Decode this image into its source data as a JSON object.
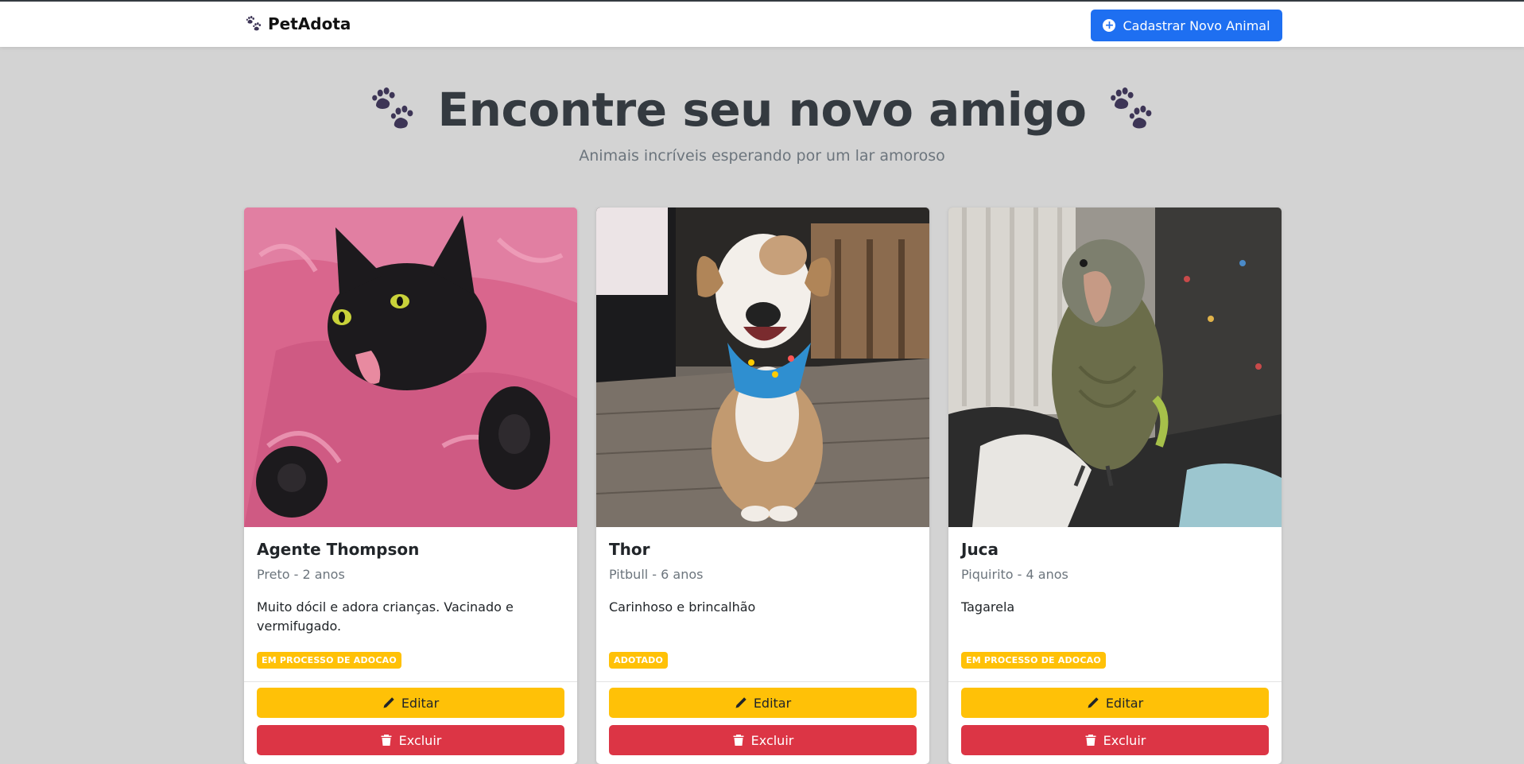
{
  "navbar": {
    "brand": "PetAdota",
    "new_button_label": "Cadastrar Novo Animal"
  },
  "hero": {
    "title": "Encontre seu novo amigo",
    "subtitle": "Animais incríveis esperando por um lar amoroso"
  },
  "cards": [
    {
      "name": "Agente Thompson",
      "breed_age": "Preto - 2 anos",
      "description": "Muito dócil e adora crianças. Vacinado e vermifugado.",
      "status": "EM PROCESSO DE ADOCAO",
      "edit_label": "Editar",
      "delete_label": "Excluir"
    },
    {
      "name": "Thor",
      "breed_age": "Pitbull - 6 anos",
      "description": "Carinhoso e brincalhão",
      "status": "ADOTADO",
      "edit_label": "Editar",
      "delete_label": "Excluir"
    },
    {
      "name": "Juca",
      "breed_age": "Piquirito - 4 anos",
      "description": "Tagarela",
      "status": "EM PROCESSO DE ADOCAO",
      "edit_label": "Editar",
      "delete_label": "Excluir"
    }
  ],
  "colors": {
    "primary": "#1e6ff1",
    "warning": "#ffc107",
    "danger": "#dc3545",
    "background": "#d3d3d3",
    "paw": "#3d3556"
  },
  "icons": [
    "paw-icon",
    "plus-circle-icon",
    "pencil-icon",
    "trash-icon"
  ]
}
